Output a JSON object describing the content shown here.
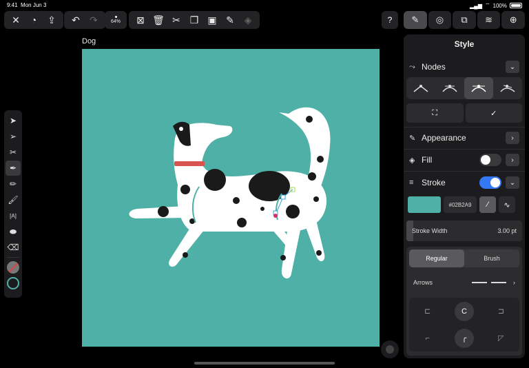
{
  "status": {
    "time": "9:41",
    "date": "Mon Jun 3",
    "battery": "100%",
    "battery_level": 1.0
  },
  "toolbar": {
    "zoom": "64%",
    "help": "?"
  },
  "document": {
    "title": "Dog"
  },
  "panel": {
    "title": "Style",
    "nodes_label": "Nodes",
    "appearance_label": "Appearance",
    "fill_label": "Fill",
    "fill_on": false,
    "stroke_label": "Stroke",
    "stroke_on": true,
    "stroke_hex": "#02B2A9",
    "stroke_color": "#4fb0a7",
    "stroke_width_label": "Stroke Width",
    "stroke_width_value": "3.00 pt",
    "mode_regular": "Regular",
    "mode_brush": "Brush",
    "arrows_label": "Arrows"
  },
  "colors": {
    "canvas": "#4fb0a7",
    "accent": "#3478f6",
    "collar": "#d9534f"
  }
}
